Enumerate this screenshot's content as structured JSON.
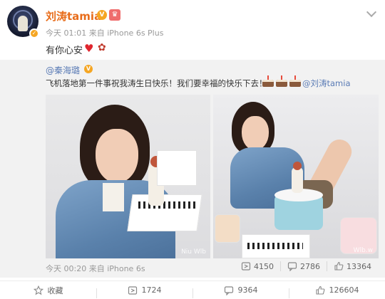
{
  "post": {
    "username": "刘涛tamia",
    "meta": "今天 01:01 来自 iPhone 6s Plus",
    "text": "有你心安"
  },
  "repost": {
    "author": "@秦海璐",
    "text": "飞机落地第一件事祝我涛生日快乐！我们要幸福的快乐下去！",
    "mention": "@刘涛tamia",
    "time": "今天 00:20 来自 iPhone 6s",
    "reposts": "4150",
    "comments": "2786",
    "likes": "13364",
    "photo_watermarks": [
      "Niu Wlb",
      "Wlb.w"
    ]
  },
  "actions": {
    "favorite": "收藏",
    "repost": "1724",
    "comment": "9364",
    "like": "126604"
  },
  "colors": {
    "username": "#e86d1b",
    "link": "#5a7bb5",
    "verified_badge": "#f5a623"
  },
  "icons": [
    "verified-icon",
    "vip-crown-icon",
    "heart-icon",
    "rose-icon",
    "cake-icon",
    "repost-icon",
    "comment-icon",
    "like-icon",
    "star-icon",
    "chevron-down-icon"
  ]
}
